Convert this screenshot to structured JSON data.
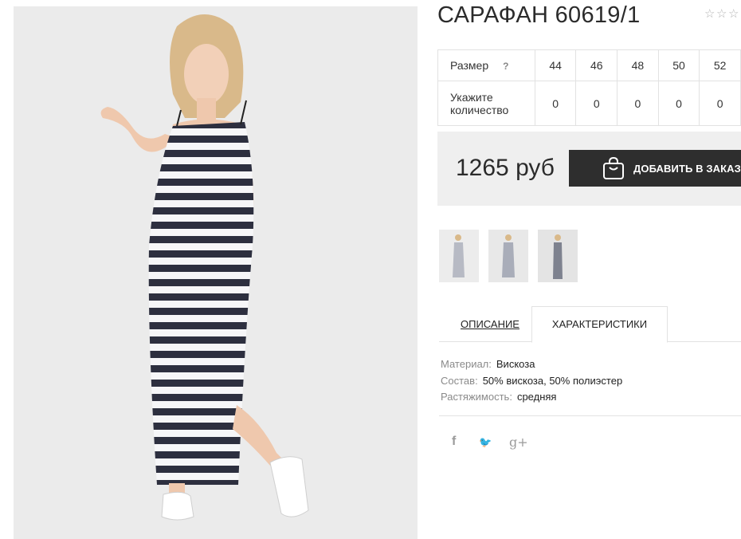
{
  "product": {
    "title": "САРАФАН 60619/1",
    "rating_icon": "star-outline-icon",
    "rating_stars": [
      "☆",
      "☆",
      "☆"
    ]
  },
  "sizes": {
    "size_label": "Размер",
    "help": "?",
    "qty_label": "Укажите количество",
    "columns": [
      "44",
      "46",
      "48",
      "50",
      "52"
    ],
    "quantities": [
      "0",
      "0",
      "0",
      "0",
      "0"
    ]
  },
  "buy": {
    "price": "1265 руб",
    "button_label": "ДОБАВИТЬ В ЗАКАЗ",
    "button_icon": "shopping-bag-icon"
  },
  "tabs": {
    "description": "ОПИСАНИЕ",
    "characteristics": "ХАРАКТЕРИСТИКИ",
    "active": "characteristics"
  },
  "specs": [
    {
      "key": "Материал:",
      "value": "Вискоза"
    },
    {
      "key": "Состав:",
      "value": "50% вискоза, 50% полиэстер"
    },
    {
      "key": "Растяжимость:",
      "value": "средняя"
    }
  ],
  "social": {
    "facebook": "f",
    "twitter": "🐦",
    "google": "g+"
  },
  "colors": {
    "button_bg": "#2e2e2e",
    "buy_box_bg": "#efefef",
    "photo_bg": "#ebebeb",
    "stripe_dark": "#2d2f3f"
  }
}
